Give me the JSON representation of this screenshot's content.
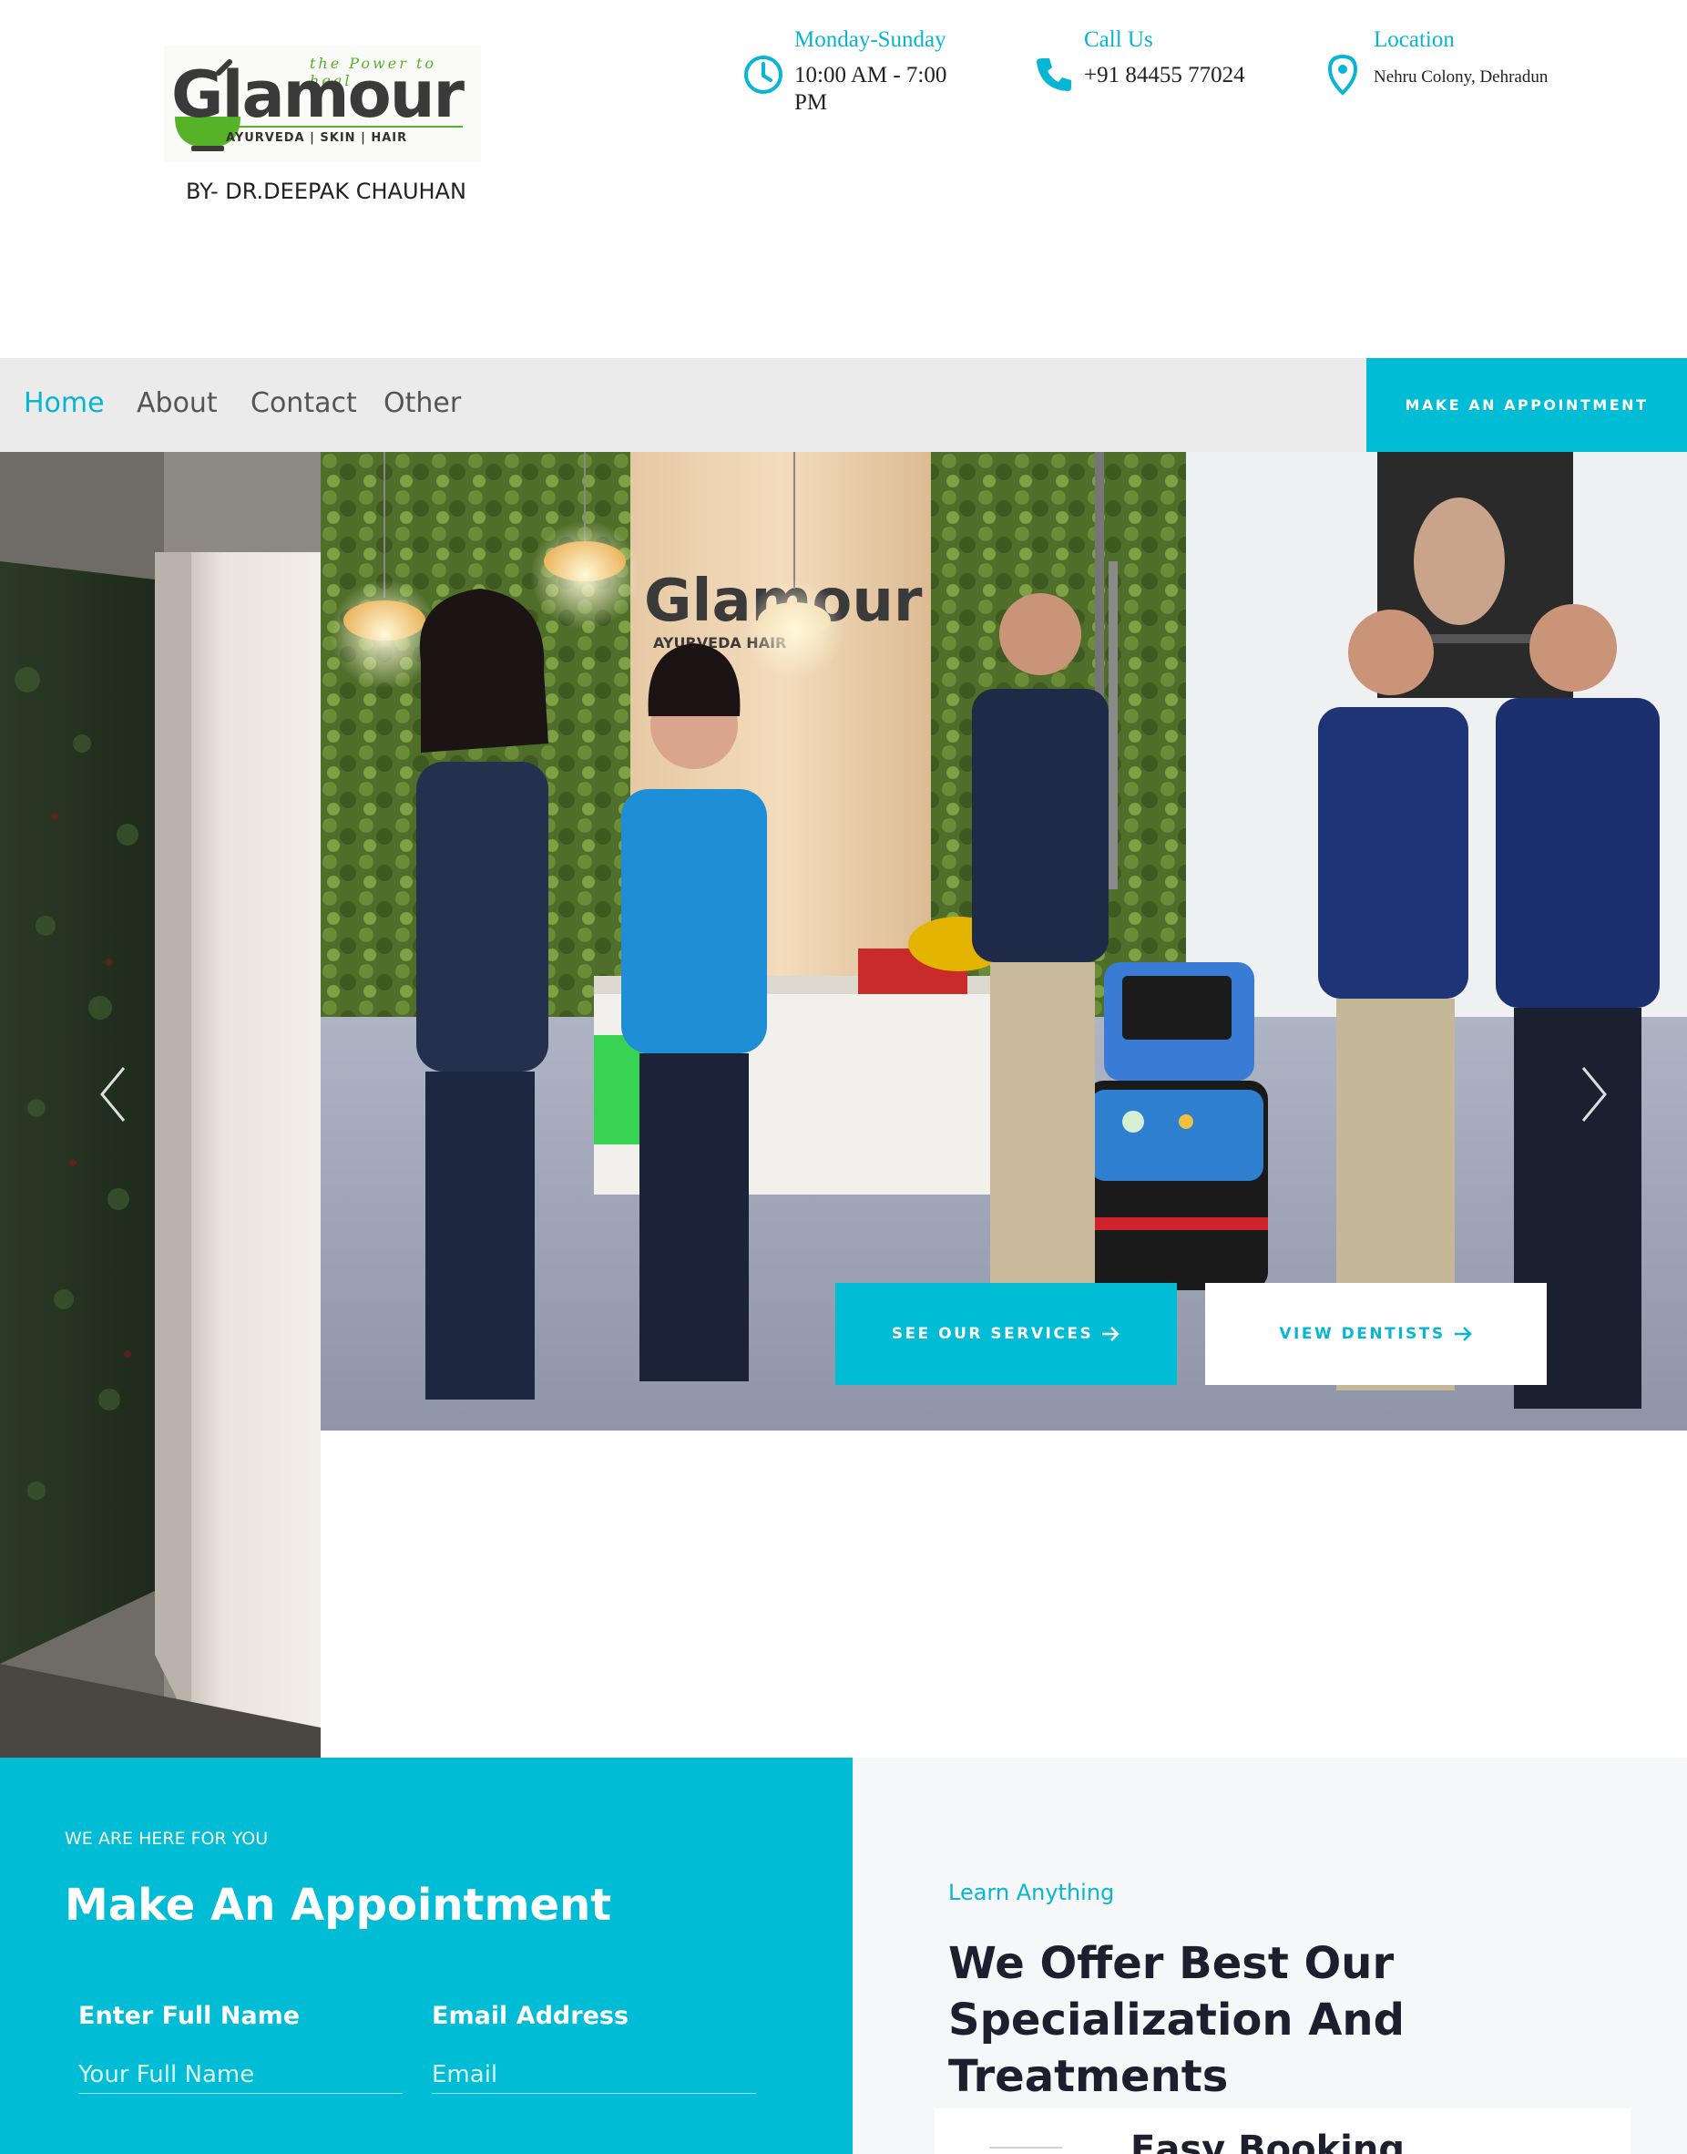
{
  "brand": {
    "tagline": "the Power to heal",
    "wordmark": "Glamour",
    "subline": "AYURVEDA  |  SKIN  |  HAIR",
    "byline": "BY- DR.DEEPAK CHAUHAN",
    "accent": "#00bcd4",
    "logo_green": "#56b226"
  },
  "header": {
    "hours": {
      "label": "Monday-Sunday",
      "value": "10:00 AM - 7:00 PM",
      "icon": "clock-icon"
    },
    "call": {
      "label": "Call Us",
      "value": "+91 84455 77024",
      "icon": "phone-icon"
    },
    "location": {
      "label": "Location",
      "value": "Nehru Colony, Dehradun",
      "icon": "map-pin-icon"
    }
  },
  "nav": {
    "items": [
      "Home",
      "About",
      "Contact",
      "Other"
    ],
    "active": "Home",
    "cta": "MAKE AN APPOINTMENT"
  },
  "hero": {
    "buttons": {
      "services": "SEE OUR SERVICES",
      "dentists": "VIEW DENTISTS"
    },
    "sign_wordmark": "Glamour",
    "sign_sub": "AYURVEDA          HAIR"
  },
  "appointment": {
    "kicker": "WE ARE HERE FOR YOU",
    "title": "Make An Appointment",
    "fields": [
      {
        "label": "Enter Full Name",
        "placeholder": "Your Full Name"
      },
      {
        "label": "Email Address",
        "placeholder": "Email"
      }
    ]
  },
  "specialization": {
    "kicker": "Learn Anything",
    "title": "We Offer Best Our Specialization And Treatments",
    "card_title": "Easy Booking"
  }
}
